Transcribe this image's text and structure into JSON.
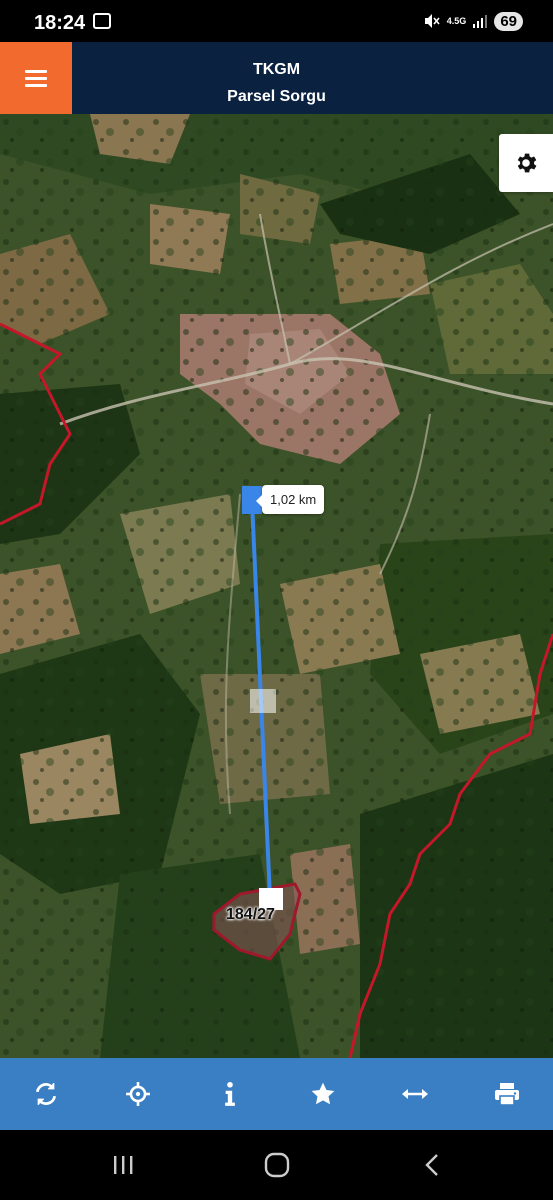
{
  "status_bar": {
    "time": "18:24",
    "network": "4.5G",
    "battery": "69",
    "icons": [
      "screen-record-icon",
      "mute-icon",
      "signal-icon"
    ]
  },
  "header": {
    "title": "TKGM",
    "subtitle": "Parsel Sorgu",
    "menu_icon": "hamburger-menu-icon",
    "menu_color": "#f26a2e",
    "background_color": "#0b2140"
  },
  "map": {
    "type": "satellite",
    "settings_icon": "gear-icon",
    "measurement": {
      "distance_label": "1,02 km",
      "line_color": "#3a86e8"
    },
    "parcel": {
      "label": "184/27",
      "outline_color": "#a0182c"
    },
    "boundary_color": "#c4182a"
  },
  "toolbar": {
    "background_color": "#3a7fc4",
    "buttons": [
      {
        "icon": "refresh-icon"
      },
      {
        "icon": "locate-icon"
      },
      {
        "icon": "info-icon"
      },
      {
        "icon": "star-icon"
      },
      {
        "icon": "measure-icon"
      },
      {
        "icon": "print-icon"
      }
    ]
  },
  "navigation": {
    "buttons": [
      "recent-apps-icon",
      "home-icon",
      "back-icon"
    ]
  }
}
